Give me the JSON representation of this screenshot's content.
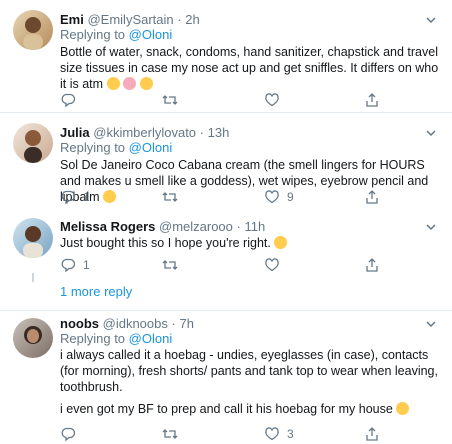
{
  "tweets": [
    {
      "name": "Emi",
      "handle": "@EmilySartain",
      "time": "2h",
      "replying_label": "Replying to",
      "replying_to": "@Oloni",
      "text": "Bottle of water, snack, condoms, hand sanitizer, chapstick and travel size tissues in case my nose act up and get sniffles. It differs on who it is atm",
      "emojis": [
        "loudly-crying-face",
        "woman-gesturing-ok",
        "face-with-tears-of-joy"
      ],
      "reply_count": "",
      "retweet_count": "",
      "like_count": ""
    },
    {
      "name": "Julia",
      "handle": "@kkimberlylovato",
      "time": "13h",
      "replying_label": "Replying to",
      "replying_to": "@Oloni",
      "text": "Sol De Janeiro Coco Cabana cream (the smell lingers for HOURS and makes u smell like a goddess), wet wipes, eyebrow pencil and lipbalm",
      "emojis": [
        "face-savoring-food"
      ],
      "reply_count": "1",
      "retweet_count": "",
      "like_count": "9"
    },
    {
      "name": "Melissa Rogers",
      "handle": "@melzarooo",
      "time": "11h",
      "text": "Just bought this so I hope you're right.",
      "emojis": [
        "grimacing-face"
      ],
      "reply_count": "1",
      "retweet_count": "",
      "like_count": ""
    },
    {
      "name": "noobs",
      "handle": "@idknoobs",
      "time": "7h",
      "replying_label": "Replying to",
      "replying_to": "@Oloni",
      "text": "i always called it a hoebag - undies, eyeglasses (in case), contacts (for morning), fresh shorts/ pants and tank top to wear when leaving, toothbrush.",
      "text2": "i even got my BF to prep and call it his hoebag for my house",
      "emojis": [
        "grinning-face-with-smiling-eyes"
      ],
      "reply_count": "",
      "retweet_count": "",
      "like_count": "3"
    }
  ],
  "more_replies": "1 more reply",
  "dot": "·",
  "colors": {
    "link": "#1b95e0",
    "muted": "#657786",
    "border": "#e6ecf0",
    "like_active": "#e0245e"
  },
  "icons": [
    "reply-icon",
    "retweet-icon",
    "like-icon",
    "share-icon",
    "chevron-down-icon"
  ]
}
